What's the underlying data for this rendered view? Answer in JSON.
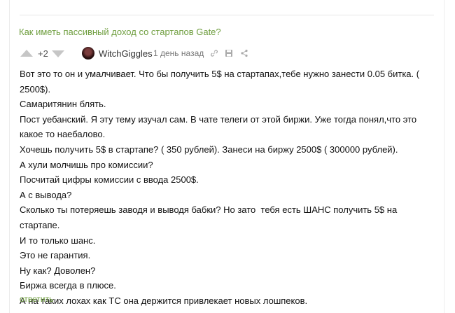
{
  "post": {
    "title": "Как иметь пассивный доход со стартапов Gate?"
  },
  "comment": {
    "rating": "+2",
    "author": "WitchGiggles",
    "timestamp": "1 день назад",
    "icons": [
      "link-icon",
      "save-icon",
      "share-icon"
    ],
    "lines": [
      "Вот это то он и умалчивает. Что бы получить 5$ на стартапах,тебе нужно занести 0.05 битка. (",
      "2500$).",
      "Самаритянин блять.",
      "Пост уебанский. Я эту тему изучал сам. В чате телеги от этой биржи. Уже тогда понял,что это",
      "какое то наебалово.",
      "Хочешь получить 5$ в стартапе? ( 350 рублей). Занеси на биржу 2500$ ( 300000 рублей).",
      "А хули молчишь про комиссии?",
      "Посчитай цифры комиссии с ввода 2500$.",
      "А с вывода?",
      "Сколько ты потеряешь заводя и выводя бабки? Но зато  тебя есть ШАНС получить 5$ на стартапе.",
      "И то только шанс.",
      "Это не гарантия.",
      "Ну как? Доволен?",
      "Биржа всегда в плюсе.",
      "А на таких лохах как ТС она держится привлекает новых лошпеков."
    ],
    "reply_label": "ответить"
  },
  "colors": {
    "accent_green": "#6f9e3f",
    "vote_arrow": "#c6c6c6",
    "muted_text": "#777777"
  }
}
